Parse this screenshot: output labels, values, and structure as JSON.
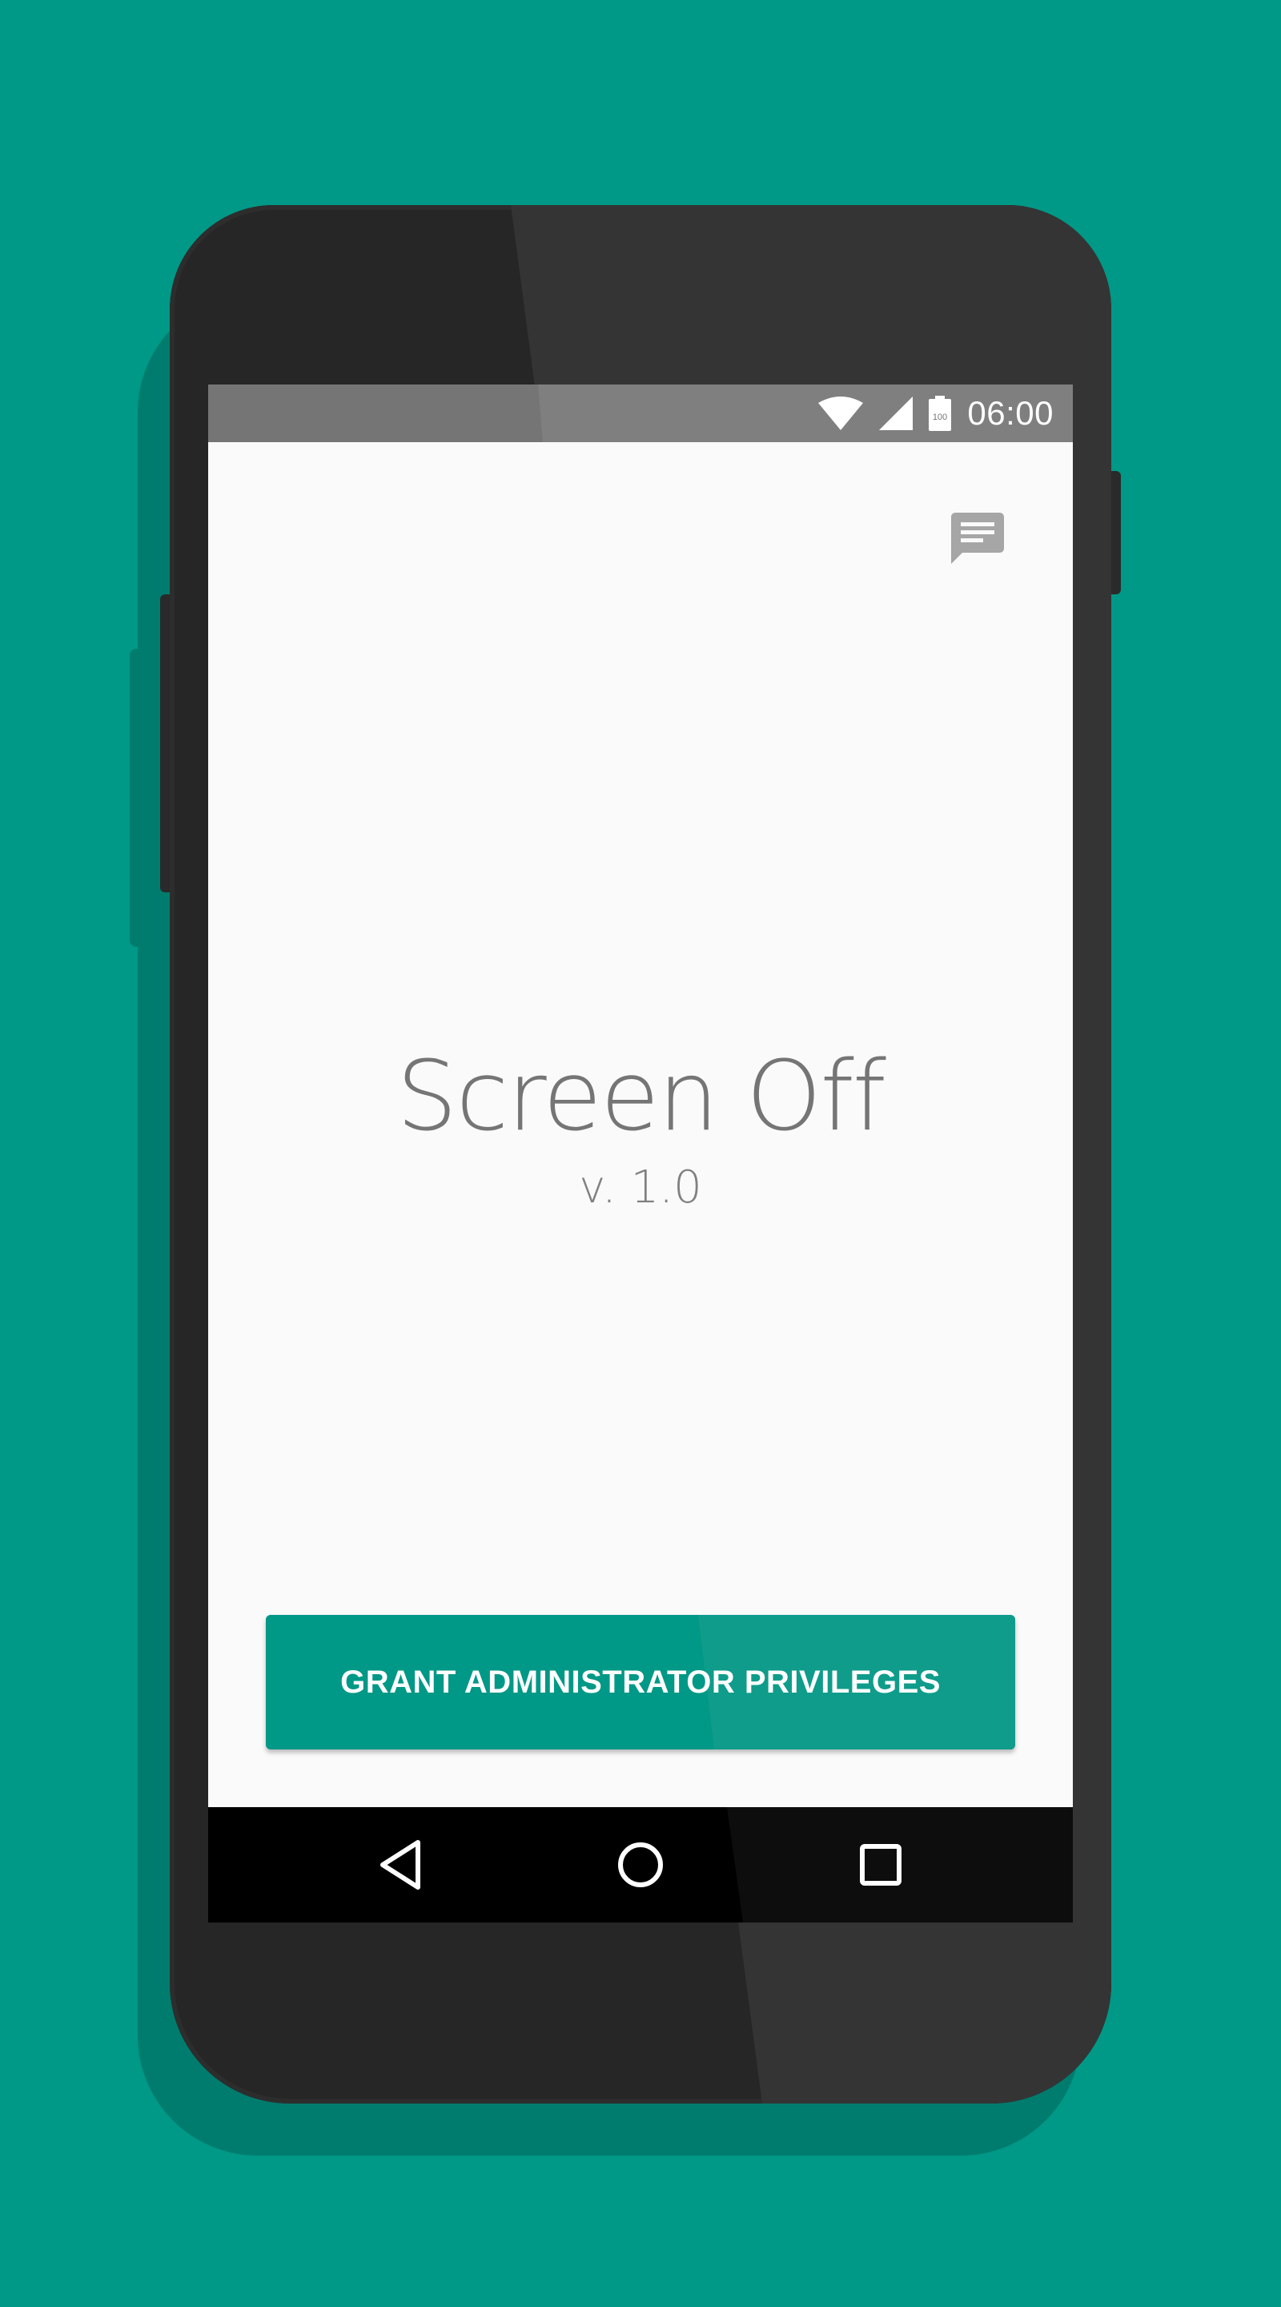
{
  "status_bar": {
    "time": "06:00",
    "battery_level": "100",
    "icons": [
      "wifi-icon",
      "cellular-signal-icon",
      "battery-icon"
    ]
  },
  "toolbar": {
    "feedback_icon": "feedback-icon"
  },
  "main": {
    "title": "Screen Off",
    "version": "v. 1.0"
  },
  "actions": {
    "grant_button_label": "GRANT ADMINISTRATOR PRIVILEGES"
  },
  "nav_bar": {
    "icons": [
      "back-icon",
      "home-icon",
      "recents-icon"
    ]
  },
  "colors": {
    "background": "#009886",
    "accent": "#009886",
    "screen": "#fafafa",
    "status_bar": "#757575",
    "text_primary": "#757575"
  }
}
